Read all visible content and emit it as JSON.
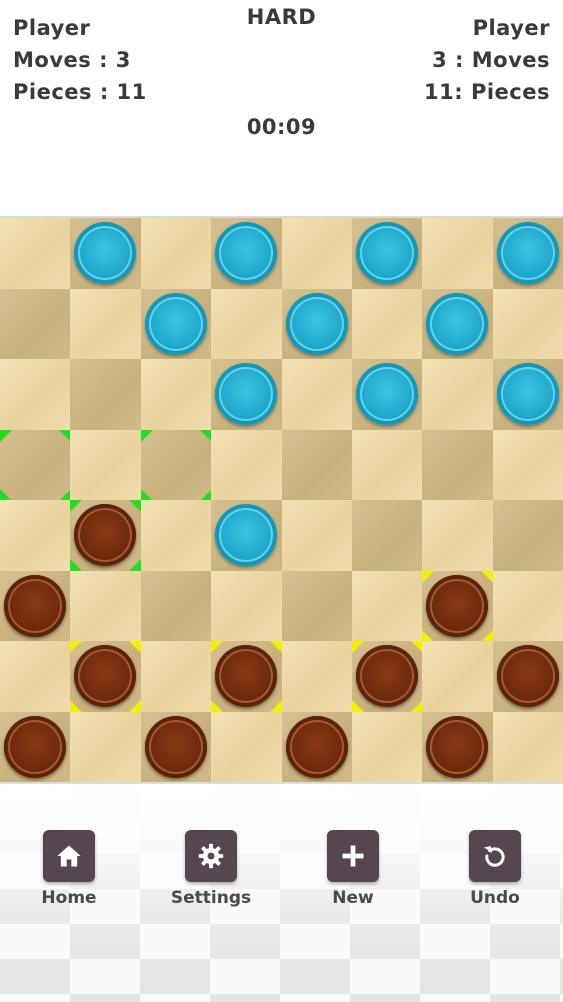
{
  "header": {
    "difficulty": "HARD",
    "timer": "00:09",
    "left": {
      "name": "Player",
      "moves": "Moves : 3",
      "pieces": "Pieces : 11"
    },
    "right": {
      "name": "Player",
      "moves": "3 : Moves",
      "pieces": "11: Pieces"
    }
  },
  "colors": {
    "light_square": "#f0dcae",
    "dark_square": "#cdb785",
    "blue_piece": "#1ea8cc",
    "red_piece": "#6f2b0d",
    "highlight_green": "#22dd22",
    "highlight_yellow": "#f4f000",
    "button_bg": "#56464f"
  },
  "board": {
    "rows": [
      ".b.b.b.b",
      "..b.b.b.",
      "...b.b.b",
      "........",
      ".r.b....",
      "r.....r.",
      ".r.r.r.r",
      "r.r.r.r."
    ],
    "green_marks": [
      [
        3,
        0
      ],
      [
        3,
        2
      ],
      [
        4,
        1
      ]
    ],
    "yellow_marks": [
      [
        5,
        6
      ],
      [
        6,
        1
      ],
      [
        6,
        3
      ],
      [
        6,
        5
      ]
    ]
  },
  "footer": {
    "buttons": [
      {
        "id": "home",
        "label": "Home",
        "icon": "home-icon"
      },
      {
        "id": "settings",
        "label": "Settings",
        "icon": "gear-icon"
      },
      {
        "id": "new",
        "label": "New",
        "icon": "plus-icon"
      },
      {
        "id": "undo",
        "label": "Undo",
        "icon": "undo-icon"
      }
    ]
  }
}
